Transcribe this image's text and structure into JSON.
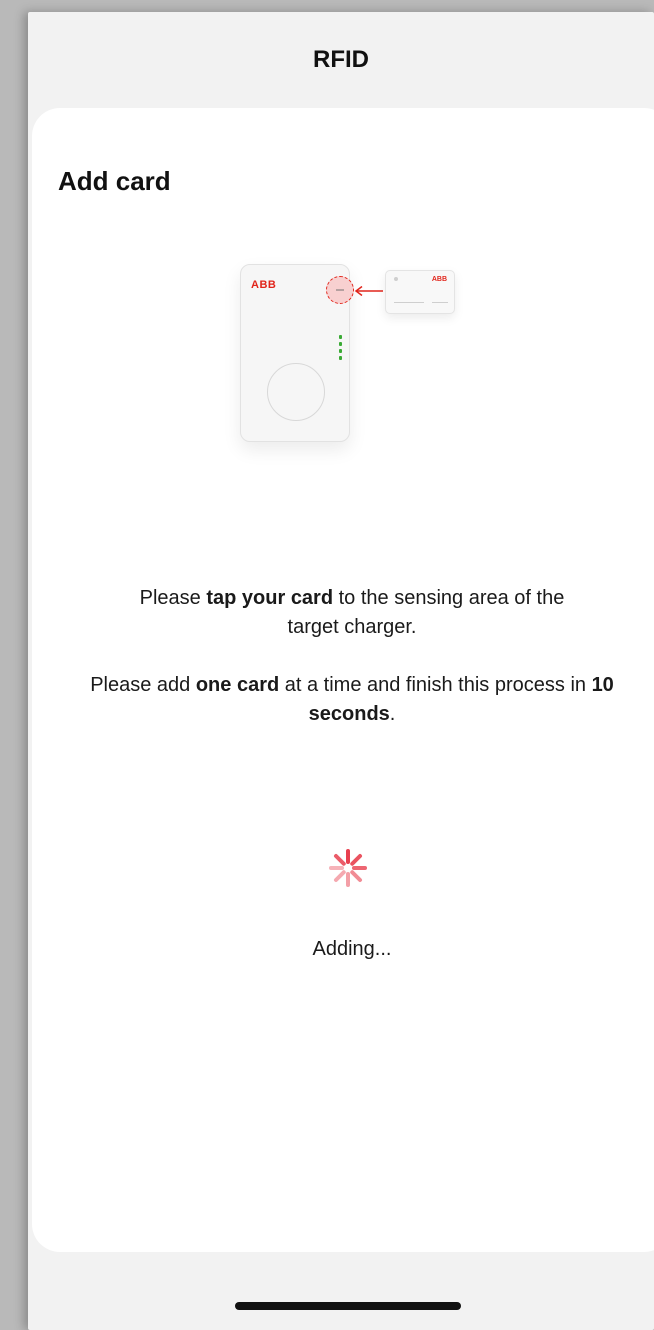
{
  "header": {
    "title": "RFID"
  },
  "sheet": {
    "title": "Add card"
  },
  "illustration": {
    "charger_logo": "ABB",
    "card_logo": "ABB"
  },
  "instructions": {
    "p1_a": "Please ",
    "p1_b": "tap your card",
    "p1_c": " to the sensing area of the target charger.",
    "p2_a": "Please add ",
    "p2_b": "one card",
    "p2_c": " at a time and finish this process in ",
    "p2_d": "10 seconds",
    "p2_e": "."
  },
  "status": {
    "text": "Adding..."
  },
  "colors": {
    "accent": "#e1251b",
    "led": "#3aaa35",
    "spinner": "#e8506a"
  }
}
